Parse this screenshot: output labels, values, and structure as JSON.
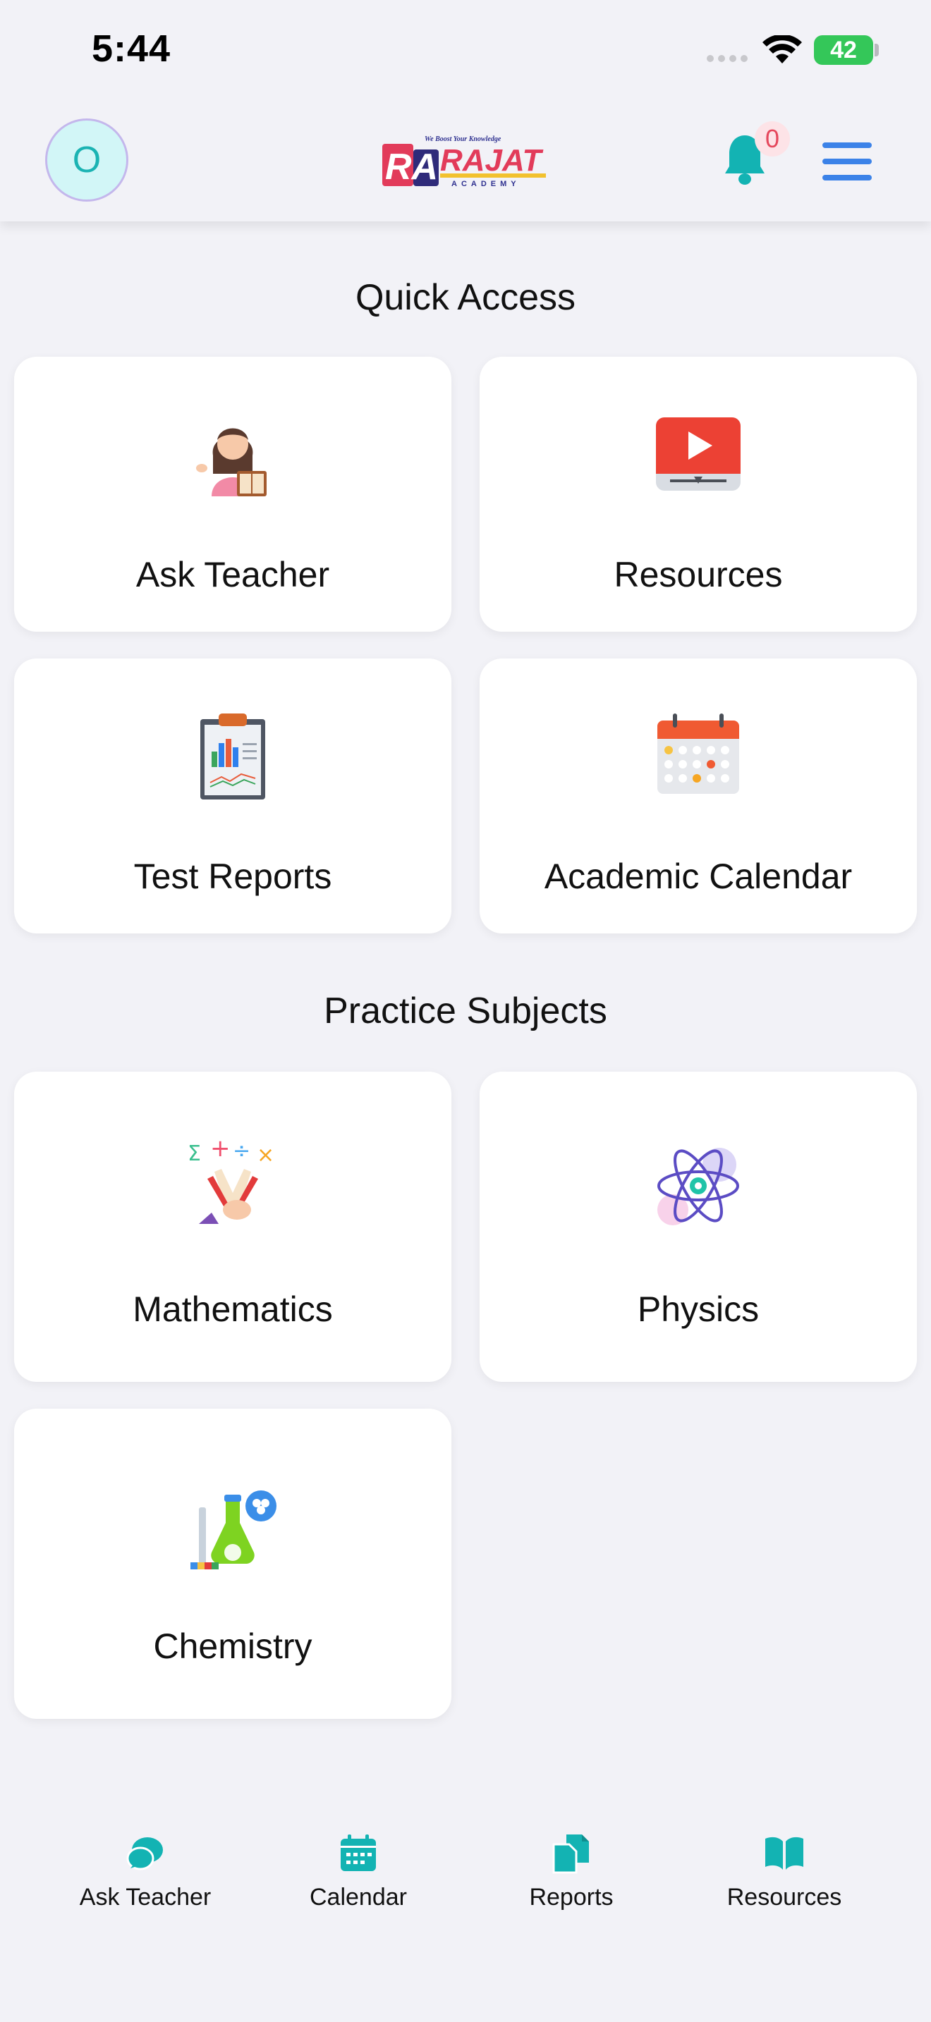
{
  "status_bar": {
    "time": "5:44",
    "battery": "42"
  },
  "header": {
    "avatar_initial": "O",
    "notification_count": "0",
    "logo_tagline": "We Boost Your Knowledge",
    "logo_ra": "RA",
    "logo_name": "RAJAT",
    "logo_sub": "ACADEMY"
  },
  "quick_access": {
    "title": "Quick Access",
    "items": [
      {
        "label": "Ask Teacher",
        "icon": "teacher-icon"
      },
      {
        "label": "Resources",
        "icon": "video-play-icon"
      },
      {
        "label": "Test Reports",
        "icon": "clipboard-chart-icon"
      },
      {
        "label": "Academic Calendar",
        "icon": "calendar-icon"
      }
    ]
  },
  "practice_subjects": {
    "title": "Practice Subjects",
    "items": [
      {
        "label": "Mathematics",
        "icon": "math-icon"
      },
      {
        "label": "Physics",
        "icon": "atom-icon"
      },
      {
        "label": "Chemistry",
        "icon": "flask-icon"
      }
    ]
  },
  "bottom_nav": {
    "items": [
      {
        "label": "Ask Teacher",
        "icon": "chat-icon"
      },
      {
        "label": "Calendar",
        "icon": "calendar-icon"
      },
      {
        "label": "Reports",
        "icon": "documents-icon"
      },
      {
        "label": "Resources",
        "icon": "book-icon"
      }
    ],
    "accent": "#13b3b3"
  }
}
